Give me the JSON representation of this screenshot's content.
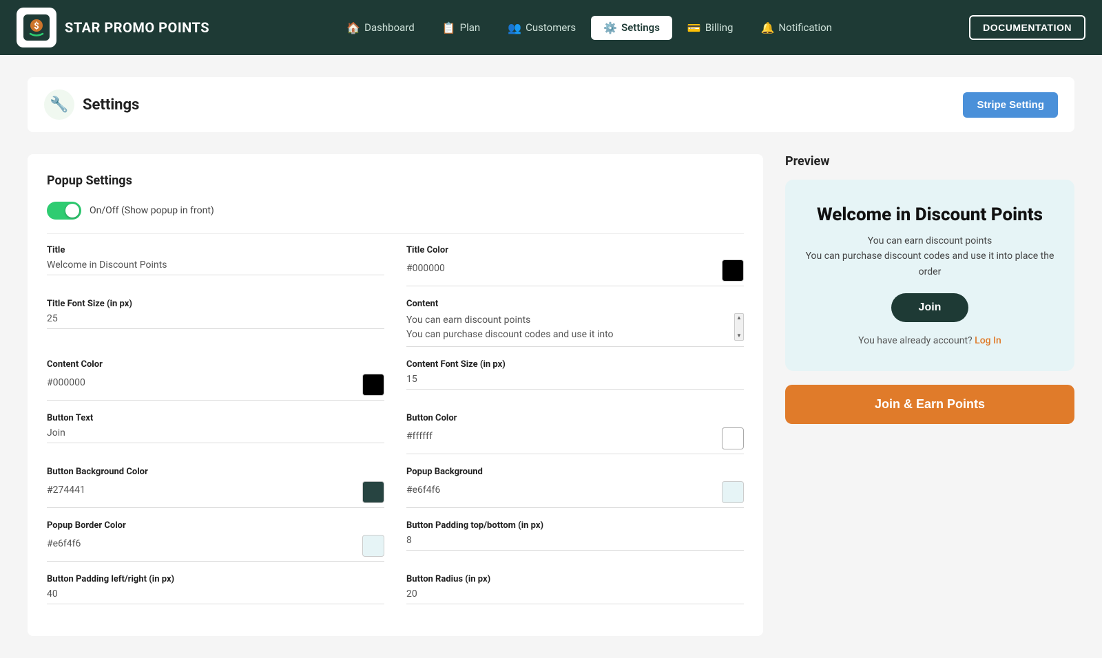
{
  "app": {
    "name": "STAR PROMO POINTS"
  },
  "nav": {
    "items": [
      {
        "id": "dashboard",
        "label": "Dashboard",
        "icon": "🏠",
        "active": false
      },
      {
        "id": "plan",
        "label": "Plan",
        "icon": "📋",
        "active": false
      },
      {
        "id": "customers",
        "label": "Customers",
        "icon": "👥",
        "active": false
      },
      {
        "id": "settings",
        "label": "Settings",
        "icon": "⚙️",
        "active": true
      },
      {
        "id": "billing",
        "label": "Billing",
        "icon": "💳",
        "active": false
      },
      {
        "id": "notification",
        "label": "Notification",
        "icon": "🔔",
        "active": false
      }
    ],
    "doc_button": "DOCUMENTATION"
  },
  "page": {
    "title": "Settings",
    "stripe_button": "Stripe Setting"
  },
  "popup_settings": {
    "section_title": "Popup Settings",
    "toggle_label": "On/Off (Show popup in front)",
    "toggle_on": true,
    "title_label": "Title",
    "title_value": "Welcome in Discount Points",
    "title_color_label": "Title Color",
    "title_color_value": "#000000",
    "title_font_size_label": "Title Font Size (in px)",
    "title_font_size_value": "25",
    "content_label": "Content",
    "content_value_line1": "You can earn discount points",
    "content_value_line2": "You can purchase discount codes and use it into",
    "content_color_label": "Content Color",
    "content_color_value": "#000000",
    "content_font_size_label": "Content Font Size (in px)",
    "content_font_size_value": "15",
    "button_text_label": "Button Text",
    "button_text_value": "Join",
    "button_color_label": "Button Color",
    "button_color_value": "#ffffff",
    "button_bg_color_label": "Button Background Color",
    "button_bg_color_value": "#274441",
    "popup_background_label": "Popup Background",
    "popup_background_value": "#e6f4f6",
    "popup_border_color_label": "Popup Border Color",
    "popup_border_color_value": "#e6f4f6",
    "btn_padding_tb_label": "Button Padding top/bottom (in px)",
    "btn_padding_tb_value": "8",
    "btn_padding_lr_label": "Button Padding left/right (in px)",
    "btn_padding_lr_value": "40",
    "btn_radius_label": "Button Radius (in px)",
    "btn_radius_value": "20"
  },
  "preview": {
    "title": "Preview",
    "popup_title": "Welcome in Discount Points",
    "popup_content_line1": "You can earn discount points",
    "popup_content_line2": "You can purchase discount codes and use it into place the order",
    "join_button": "Join",
    "login_text": "You have already account?",
    "login_link": "Log In",
    "earn_button": "Join & Earn Points"
  }
}
